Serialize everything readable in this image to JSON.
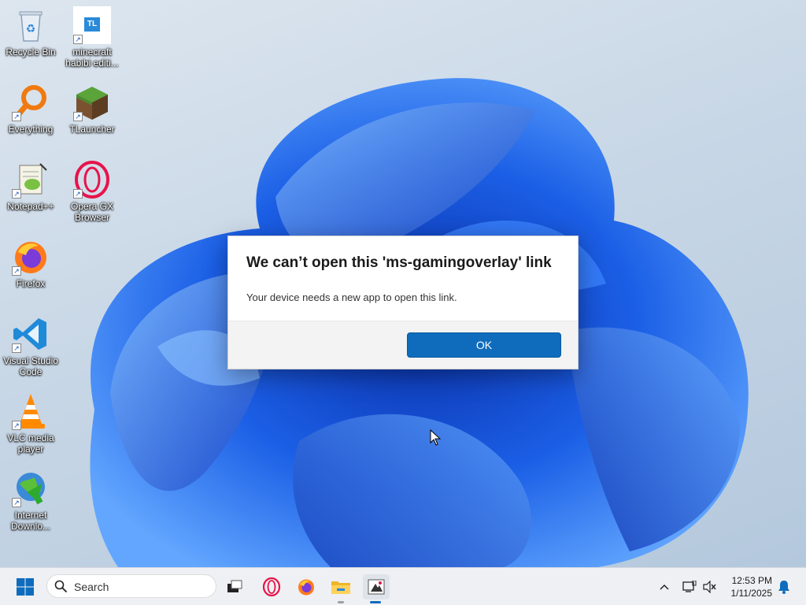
{
  "desktop": {
    "icons": [
      {
        "label": "Recycle Bin"
      },
      {
        "label": "minecraft habibi editi..."
      },
      {
        "label": "Everything"
      },
      {
        "label": "TLauncher"
      },
      {
        "label": "Notepad++"
      },
      {
        "label": "Opera GX Browser"
      },
      {
        "label": "Firefox"
      },
      {
        "label": "Visual Studio Code"
      },
      {
        "label": "VLC media player"
      },
      {
        "label": "Internet Downlo..."
      }
    ],
    "tl_badge": "TL"
  },
  "dialog": {
    "title": "We can’t open this 'ms-gamingoverlay' link",
    "message": "Your device needs a new app to open this link.",
    "ok_label": "OK"
  },
  "taskbar": {
    "search_placeholder": "Search",
    "time": "12:53 PM",
    "date": "1/11/2025"
  },
  "colors": {
    "accent": "#0f6cbd",
    "wallpaper_blue": "#1e5fe0"
  }
}
